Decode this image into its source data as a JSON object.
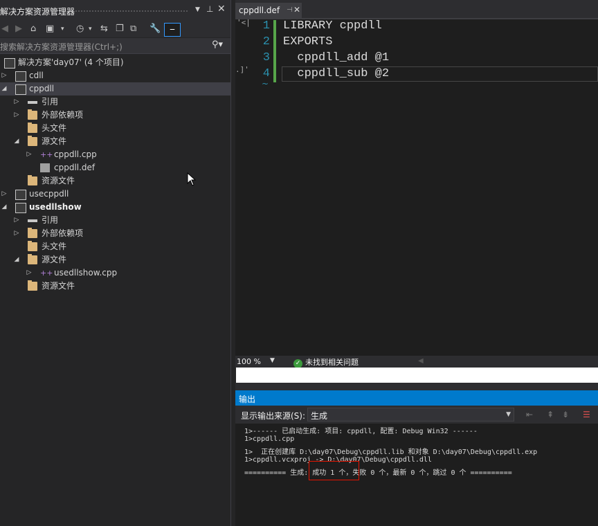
{
  "solution_explorer": {
    "title": "解决方案资源管理器",
    "title_icons": [
      "dropdown-icon",
      "pin-icon",
      "close-icon"
    ],
    "search_placeholder": "搜索解决方案资源管理器(Ctrl+;)",
    "tree": [
      {
        "label": "解决方案'day07' (4 个项目)",
        "icon": "solution-icon",
        "arrow": "",
        "bold": false
      },
      {
        "label": "cdll",
        "icon": "project-icon",
        "arrow": "collapsed",
        "bold": false
      },
      {
        "label": "cppdll",
        "icon": "project-icon",
        "arrow": "expanded",
        "bold": false,
        "selected": true
      },
      {
        "label": "引用",
        "icon": "references-icon",
        "arrow": "collapsed",
        "bold": false
      },
      {
        "label": "外部依赖项",
        "icon": "external-deps-icon",
        "arrow": "collapsed",
        "bold": false
      },
      {
        "label": "头文件",
        "icon": "folder-icon",
        "arrow": "",
        "bold": false
      },
      {
        "label": "源文件",
        "icon": "folder-open-icon",
        "arrow": "expanded",
        "bold": false
      },
      {
        "label": "cppdll.cpp",
        "icon": "cpp-file-icon",
        "arrow": "collapsed",
        "bold": false
      },
      {
        "label": "cppdll.def",
        "icon": "def-file-icon",
        "arrow": "",
        "bold": false
      },
      {
        "label": "资源文件",
        "icon": "folder-icon",
        "arrow": "",
        "bold": false
      },
      {
        "label": "usecppdll",
        "icon": "project-icon",
        "arrow": "collapsed",
        "bold": false
      },
      {
        "label": "usedllshow",
        "icon": "project-icon",
        "arrow": "expanded",
        "bold": true
      },
      {
        "label": "引用",
        "icon": "references-icon",
        "arrow": "collapsed",
        "bold": false
      },
      {
        "label": "外部依赖项",
        "icon": "external-deps-icon",
        "arrow": "collapsed",
        "bold": false
      },
      {
        "label": "头文件",
        "icon": "folder-icon",
        "arrow": "",
        "bold": false
      },
      {
        "label": "源文件",
        "icon": "folder-open-icon",
        "arrow": "expanded",
        "bold": false
      },
      {
        "label": "usedllshow.cpp",
        "icon": "cpp-file-icon",
        "arrow": "collapsed",
        "bold": false
      },
      {
        "label": "资源文件",
        "icon": "folder-icon",
        "arrow": "",
        "bold": false
      }
    ]
  },
  "editor": {
    "tab_label": "cppdll.def",
    "line_numbers": [
      "1",
      "2",
      "3",
      "4"
    ],
    "lines": [
      "LIBRARY cppdll",
      "EXPORTS",
      "  cppdll_add @1",
      "  cppdll_sub @2"
    ],
    "gutter_fragments": [
      "'<|",
      ".]'"
    ],
    "zoom": "100 %",
    "issues_status": "未找到相关问题"
  },
  "output": {
    "title": "输出",
    "source_label": "显示输出来源(S):",
    "source_value": "生成",
    "lines": [
      "1>------ 已启动生成: 项目: cppdll, 配置: Debug Win32 ------",
      "1>cppdll.cpp",
      "1>  正在创建库 D:\\day07\\Debug\\cppdll.lib 和对象 D:\\day07\\Debug\\cppdll.exp",
      "1>cppdll.vcxproj -> D:\\day07\\Debug\\cppdll.dll",
      "========== 生成: 成功 1 个，失败 0 个，最新 0 个，跳过 0 个 =========="
    ]
  },
  "colors": {
    "accent": "#007acc",
    "highlight_box": "#e51400",
    "change_bar": "#57a64a"
  }
}
